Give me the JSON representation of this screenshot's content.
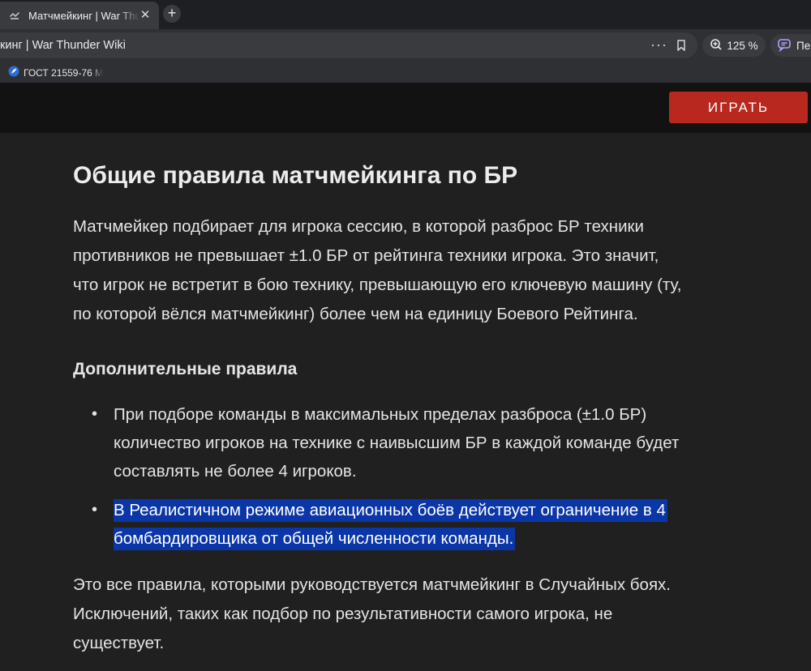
{
  "browser": {
    "tab_title": "Матчмейкинг | War Thunder Wiki",
    "tab_favicon_icon": "war-thunder-icon",
    "url_text": "кинг | War Thunder Wiki",
    "zoom_level": "125 %",
    "ai_button_label": "Пе",
    "bookmarks": [
      {
        "label": "ГОСТ 21559-76 М",
        "icon": "feather-icon"
      }
    ]
  },
  "site_header": {
    "play_button_label": "ИГРАТЬ",
    "play_button_color": "#b8281f"
  },
  "article": {
    "heading": "Общие правила матчмейкинга по БР",
    "intro_lines": [
      "Матчмейкер подбирает для игрока сессию, в которой разброс БР техники",
      "противников не превышает ±1.0 БР от рейтинга техники игрока. Это значит,",
      "что игрок не встретит в бою технику, превышающую его ключевую машину (ту,",
      "по которой вёлся матчмейкинг) более чем на единицу Боевого Рейтинга."
    ],
    "subheading": "Дополнительные правила",
    "rules": [
      {
        "lines": [
          "При подборе команды в максимальных пределах разброса (±1.0 БР)",
          "количество игроков на технике с наивысшим БР в каждой команде будет",
          "составлять не более 4 игроков."
        ],
        "selected": false
      },
      {
        "lines": [
          "В Реалистичном режиме авиационных боёв действует ограничение в 4",
          "бомбардировщика от общей численности команды."
        ],
        "selected": true
      }
    ],
    "outro_lines": [
      "Это все правила, которыми руководствуется матчмейкинг в Случайных боях.",
      "Исключений, таких как подбор по результативности самого игрока, не",
      "существует."
    ],
    "selection_color": "#0a36a8"
  }
}
